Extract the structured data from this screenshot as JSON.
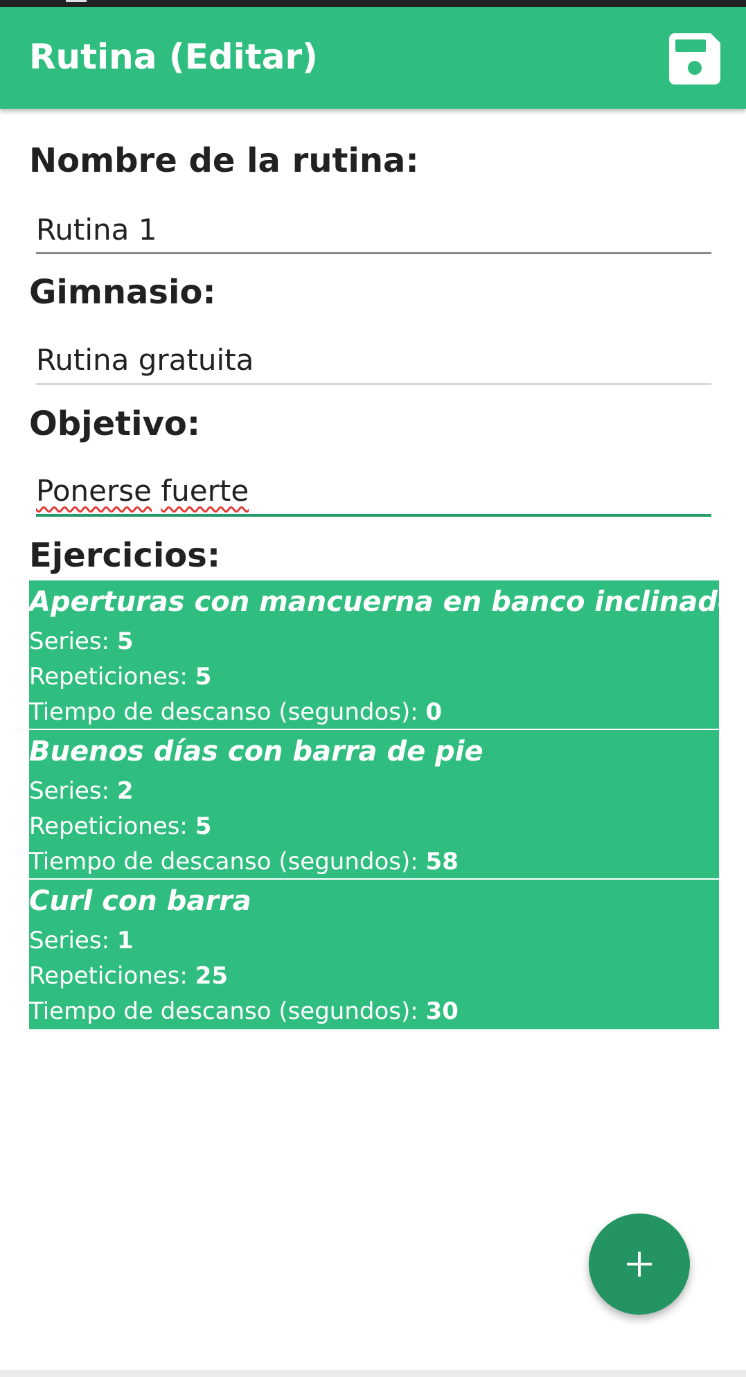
{
  "app_bar": {
    "title": "Rutina (Editar)",
    "save_icon": "floppy-disk-icon",
    "color": "#2fbe7f"
  },
  "form": {
    "name_label": "Nombre de la rutina:",
    "name_value": "Rutina 1",
    "gym_label": "Gimnasio:",
    "gym_value": "Rutina gratuita",
    "goal_label": "Objetivo:",
    "goal_value_words": [
      "Ponerse",
      "fuerte"
    ],
    "exercises_label": "Ejercicios:"
  },
  "exercise_labels": {
    "series": "Series: ",
    "reps": "Repeticiones: ",
    "rest": "Tiempo de descanso (segundos): "
  },
  "exercises": [
    {
      "name": "Aperturas con mancuerna en banco inclinado",
      "series": "5",
      "reps": "5",
      "rest": "0"
    },
    {
      "name": "Buenos días con barra de pie",
      "series": "2",
      "reps": "5",
      "rest": "58"
    },
    {
      "name": "Curl con barra",
      "series": "1",
      "reps": "25",
      "rest": "30"
    }
  ],
  "fab": {
    "icon": "plus-icon",
    "color": "#239462"
  }
}
